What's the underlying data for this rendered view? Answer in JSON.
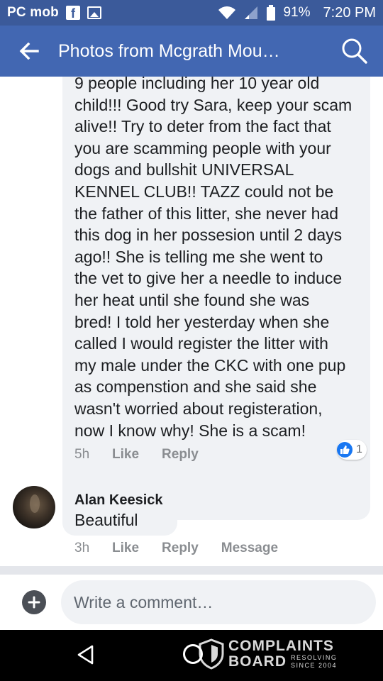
{
  "status_bar": {
    "carrier": "PC mob",
    "battery": "91%",
    "time": "7:20 PM",
    "icons": [
      "facebook-icon",
      "image-icon",
      "wifi-icon",
      "signal-icon",
      "battery-icon"
    ]
  },
  "app_bar": {
    "title": "Photos from Mcgrath Mou…",
    "icons": [
      "back-arrow-icon",
      "search-icon"
    ]
  },
  "comments": [
    {
      "text_lines": [
        "9 people including her 10 year old",
        "child!!! Good try Sara, keep your scam",
        "alive!! Try to deter from the fact that",
        "you are scamming people with your",
        "dogs and bullshit UNIVERSAL",
        "KENNEL CLUB!! TAZZ could not be",
        "the father of this litter, she never had",
        "this dog in her possesion until 2 days",
        "ago!! She is telling me she went to",
        "the vet to give her a needle to induce",
        "her heat until she found she was",
        "bred! I told her yesterday when she",
        "called I would register the litter with",
        "my male under the CKC with one pup",
        "as compenstion and she said she",
        "wasn't worried about registeration,",
        "now I know why! She is a scam!"
      ],
      "time": "5h",
      "like_label": "Like",
      "reply_label": "Reply",
      "reaction_count": "1"
    },
    {
      "author": "Alan Keesick",
      "text": "Beautiful",
      "time": "3h",
      "like_label": "Like",
      "reply_label": "Reply",
      "message_label": "Message"
    }
  ],
  "composer": {
    "placeholder": "Write a comment…",
    "value": ""
  },
  "watermark": {
    "line1": "COMPLAINTS",
    "line2": "BOARD",
    "tag1": "RESOLVING",
    "tag2": "SINCE 2004"
  },
  "colors": {
    "status_bar": "#3b5a9a",
    "app_bar": "#4267b2",
    "bubble": "#f0f2f5",
    "like_blue": "#1877f2"
  }
}
